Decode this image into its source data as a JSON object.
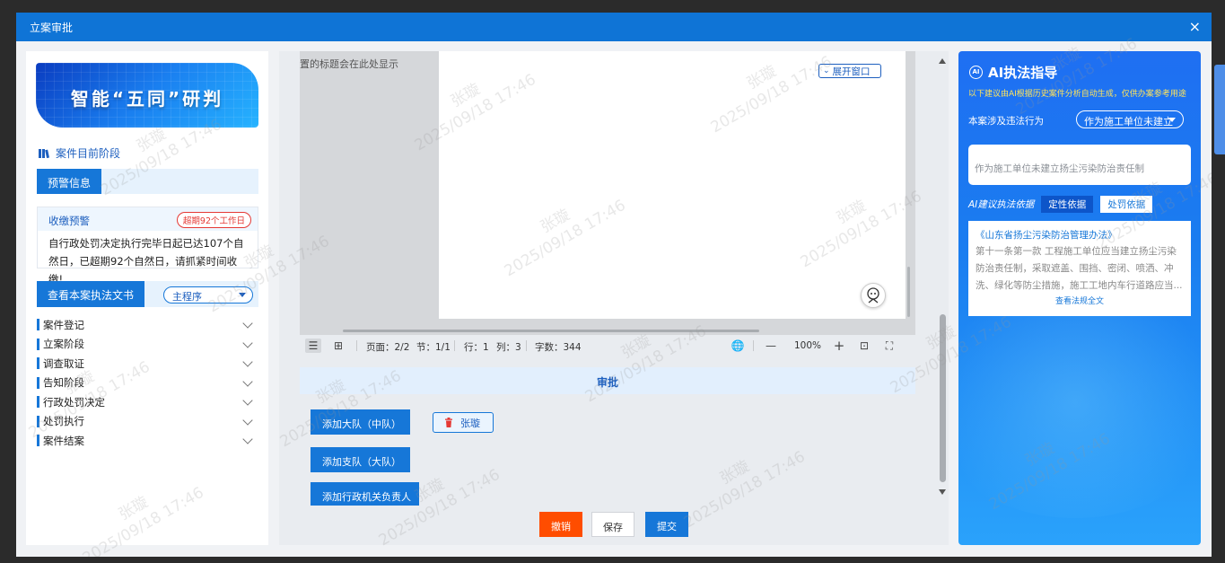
{
  "window": {
    "title": "立案审批",
    "close": "×"
  },
  "left": {
    "banner": "智能“五同”研判",
    "stage_title": "案件目前阶段",
    "warning_section": "预警信息",
    "warning": {
      "label": "收缴预警",
      "badge": "超期92个工作日",
      "content": "自行政处罚决定执行完毕日起已达107个自然日，已超期92个自然日，请抓紧时间收缴!"
    },
    "docs_tab": "查看本案执法文书",
    "docs_select": "主程序",
    "menu": [
      "案件登记",
      "立案阶段",
      "调查取证",
      "告知阶段",
      "行政处罚决定",
      "处罚执行",
      "案件结案"
    ]
  },
  "center": {
    "title_hint": "置的标题会在此处显示",
    "expand_btn": "展开窗口",
    "status": {
      "page": "页面：2/2",
      "section": "节：1/1",
      "row": "行：1",
      "col": "列：3",
      "words": "字数：344",
      "zoom": "100%",
      "minus": "—",
      "plus": "+"
    },
    "approve_title": "审批",
    "add_team_zd": "添加大队（中队）",
    "add_team_dd": "添加支队（大队）",
    "add_leader": "添加行政机关负责人",
    "person": "张璇",
    "cancel": "撤销",
    "save": "保存",
    "submit": "提交"
  },
  "right": {
    "title": "AI执法指导",
    "ai_badge": "AI",
    "subtitle": "以下建议由AI根据历史案件分析自动生成，仅供办案参考用途",
    "behavior_label": "本案涉及违法行为",
    "behavior_select": "作为施工单位未建立",
    "behavior_text": "作为施工单位未建立扬尘污染防治责任制",
    "basis_label": "AI建议执法依据",
    "tab_define": "定性依据",
    "tab_punish": "处罚依据",
    "law_title": "《山东省扬尘污染防治管理办法》",
    "law_content": "第十一条第一款 工程施工单位应当建立扬尘污染防治责任制，采取遮盖、围挡、密闭、喷洒、冲洗、绿化等防尘措施，施工工地内车行道路应当...",
    "law_link": "查看法规全文"
  },
  "watermark": {
    "name": "张璇",
    "time": "2025/09/18 17:46"
  },
  "colors": {
    "primary": "#1677d8",
    "danger": "#ff4d00",
    "title_bar": "#0f74d6"
  }
}
